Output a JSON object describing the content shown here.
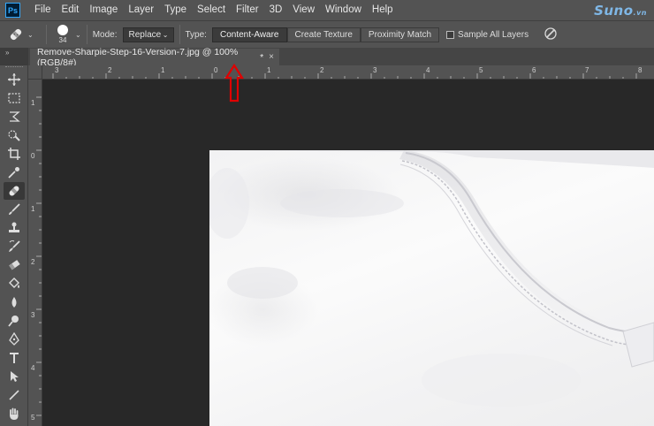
{
  "app": {
    "logo_text": "Ps"
  },
  "menu": [
    "File",
    "Edit",
    "Image",
    "Layer",
    "Type",
    "Select",
    "Filter",
    "3D",
    "View",
    "Window",
    "Help"
  ],
  "watermark": {
    "text": "Suno",
    "suffix": ".vn"
  },
  "options": {
    "brush_size": "34",
    "mode_label": "Mode:",
    "mode_value": "Replace",
    "type_label": "Type:",
    "type_buttons": [
      "Content-Aware",
      "Create Texture",
      "Proximity Match"
    ],
    "active_type": "Content-Aware",
    "sample_all_layers": "Sample All Layers",
    "sample_all_layers_checked": false
  },
  "document": {
    "tab_title": "Remove-Sharpie-Step-16-Version-7.jpg @ 100% (RGB/8#)",
    "modified_marker": "*",
    "close_glyph": "×"
  },
  "rulers": {
    "top": [
      "3",
      "2",
      "1",
      "0",
      "1",
      "2",
      "3",
      "4",
      "5",
      "6",
      "7",
      "8"
    ],
    "left": [
      "1",
      "0",
      "1",
      "2",
      "3",
      "4",
      "5"
    ]
  },
  "tools": [
    "move-icon",
    "marquee-icon",
    "lasso-icon",
    "quick-selection-icon",
    "crop-icon",
    "eyedropper-icon",
    "healing-brush-icon",
    "brush-icon",
    "clone-stamp-icon",
    "history-brush-icon",
    "eraser-icon",
    "paint-bucket-icon",
    "blur-icon",
    "dodge-icon",
    "pen-icon",
    "type-icon",
    "path-selection-icon",
    "line-icon",
    "hand-icon"
  ],
  "active_tool": "healing-brush-icon",
  "colors": {
    "panel": "#535353",
    "canvas": "#282828",
    "annotation_red": "#e00000",
    "accent": "#31a8ff"
  }
}
